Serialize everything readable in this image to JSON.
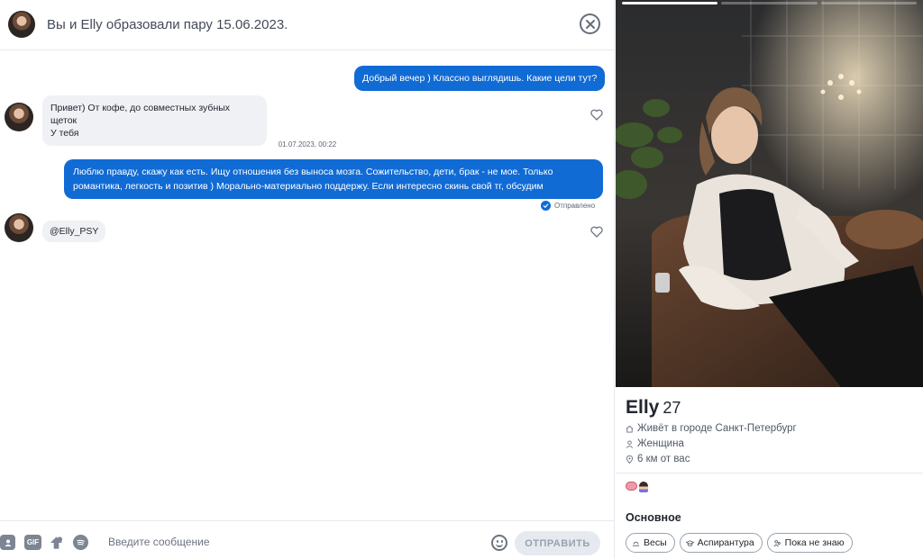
{
  "header": {
    "title": "Вы и Elly образовали пару 15.06.2023."
  },
  "messages": [
    {
      "direction": "out",
      "text": "Добрый вечер ) Классно выглядишь. Какие цели тут?"
    },
    {
      "direction": "in",
      "lines": [
        "Привет) От кофе, до совместных зубных щеток",
        "У тебя"
      ]
    },
    {
      "timestamp": "01.07.2023, 00:22"
    },
    {
      "direction": "out",
      "lines": [
        "Люблю правду, скажу как есть. Ищу отношения без выноса мозга. Сожительство, дети, брак - не мое. Только",
        "романтика, легкость и позитив ) Морально-материально поддержу. Если интересно скинь свой тг, обсудим"
      ],
      "status": "Отправлено"
    },
    {
      "direction": "in",
      "text": "@Elly_PSY"
    }
  ],
  "composer": {
    "placeholder": "Введите сообщение",
    "gif_label": "GIF",
    "send_label": "ОТПРАВИТЬ",
    "icons": [
      "contact-card-icon",
      "gif-icon",
      "sticker-icon",
      "spotify-icon",
      "emoji-icon"
    ]
  },
  "profile": {
    "name": "Elly",
    "age": "27",
    "city": "Живёт в городе Санкт-Петербург",
    "gender": "Женщина",
    "distance": "6 км от вас",
    "photo_count": 3,
    "active_photo": 1,
    "section_title": "Основное",
    "chips": [
      {
        "label": "Весы",
        "icon": "zodiac-icon"
      },
      {
        "label": "Аспирантура",
        "icon": "graduation-cap-icon"
      },
      {
        "label": "Пока не знаю",
        "icon": "family-icon"
      }
    ]
  },
  "colors": {
    "accent_blue": "#106bd5",
    "incoming_bubble": "#eff1f5",
    "text_dark": "#21262e",
    "muted": "#6b7380"
  }
}
